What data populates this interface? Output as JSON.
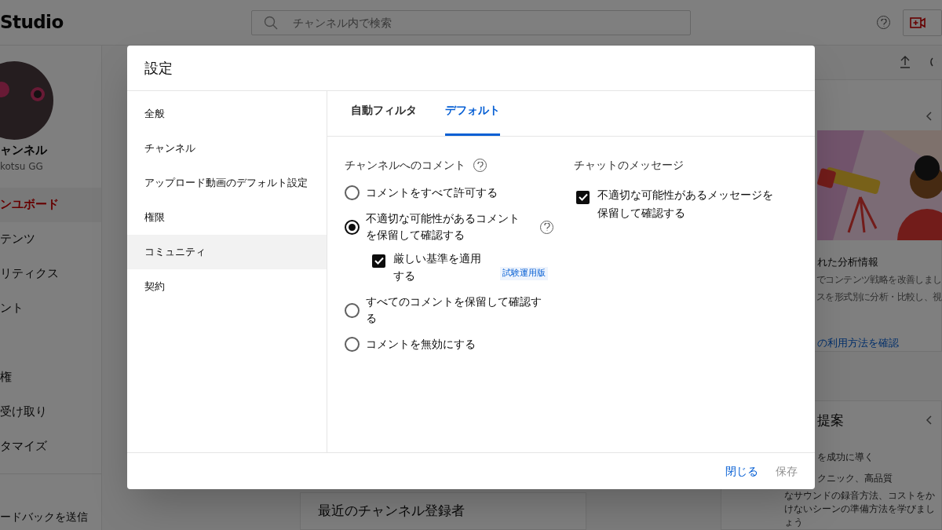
{
  "app": {
    "logo": "Studio",
    "search": {
      "placeholder": "チャンネル内で検索"
    }
  },
  "sidebar": {
    "channel_name": "ャンネル",
    "channel_handle": "kotsu GG",
    "items": [
      {
        "label": "ンユボード",
        "selected": true
      },
      {
        "label": "テンツ",
        "selected": false
      },
      {
        "label": "リティクス",
        "selected": false
      },
      {
        "label": "ント",
        "selected": false
      },
      {
        "label": "権",
        "selected": false
      },
      {
        "label": "受け取り",
        "selected": false
      },
      {
        "label": "タマイズ",
        "selected": false
      }
    ],
    "footer_item": "ードバックを送信"
  },
  "main": {
    "card_title": "最近のチャンネル登録者"
  },
  "right_panel": {
    "insight_card": {
      "title": "れた分析情報",
      "lines": [
        "でコンテンツ戦略を改善しまし",
        "スを形式別に分析・比較し、視"
      ],
      "link": "の利用方法を確認"
    },
    "ideas_card": {
      "title": "提案",
      "lines": [
        "を成功に導く",
        "クニック、高品質",
        "なサウンドの録音方法、コストをか",
        "けないシーンの準備方法を学びまし",
        "ょう"
      ]
    }
  },
  "dialog": {
    "title": "設定",
    "nav": [
      {
        "label": "全般",
        "selected": false
      },
      {
        "label": "チャンネル",
        "selected": false
      },
      {
        "label": "アップロード動画のデフォルト設定",
        "selected": false
      },
      {
        "label": "権限",
        "selected": false
      },
      {
        "label": "コミュニティ",
        "selected": true
      },
      {
        "label": "契約",
        "selected": false
      }
    ],
    "tabs": [
      {
        "label": "自動フィルタ",
        "selected": false
      },
      {
        "label": "デフォルト",
        "selected": true
      }
    ],
    "comments": {
      "heading": "チャンネルへのコメント",
      "options": [
        {
          "label": "コメントをすべて許可する",
          "selected": false
        },
        {
          "label": "不適切な可能性があるコメントを保留して確認する",
          "selected": true,
          "help": true,
          "sub_option": {
            "label": "厳しい基準を適用する",
            "checked": true,
            "badge": "試験運用版"
          }
        },
        {
          "label": "すべてのコメントを保留して確認する",
          "selected": false
        },
        {
          "label": "コメントを無効にする",
          "selected": false
        }
      ]
    },
    "chat": {
      "heading": "チャットのメッセージ",
      "option": {
        "label": "不適切な可能性があるメッセージを保留して確認する",
        "checked": true
      }
    },
    "buttons": [
      {
        "label": "閉じる",
        "disabled": false
      },
      {
        "label": "保存",
        "disabled": true
      }
    ]
  }
}
